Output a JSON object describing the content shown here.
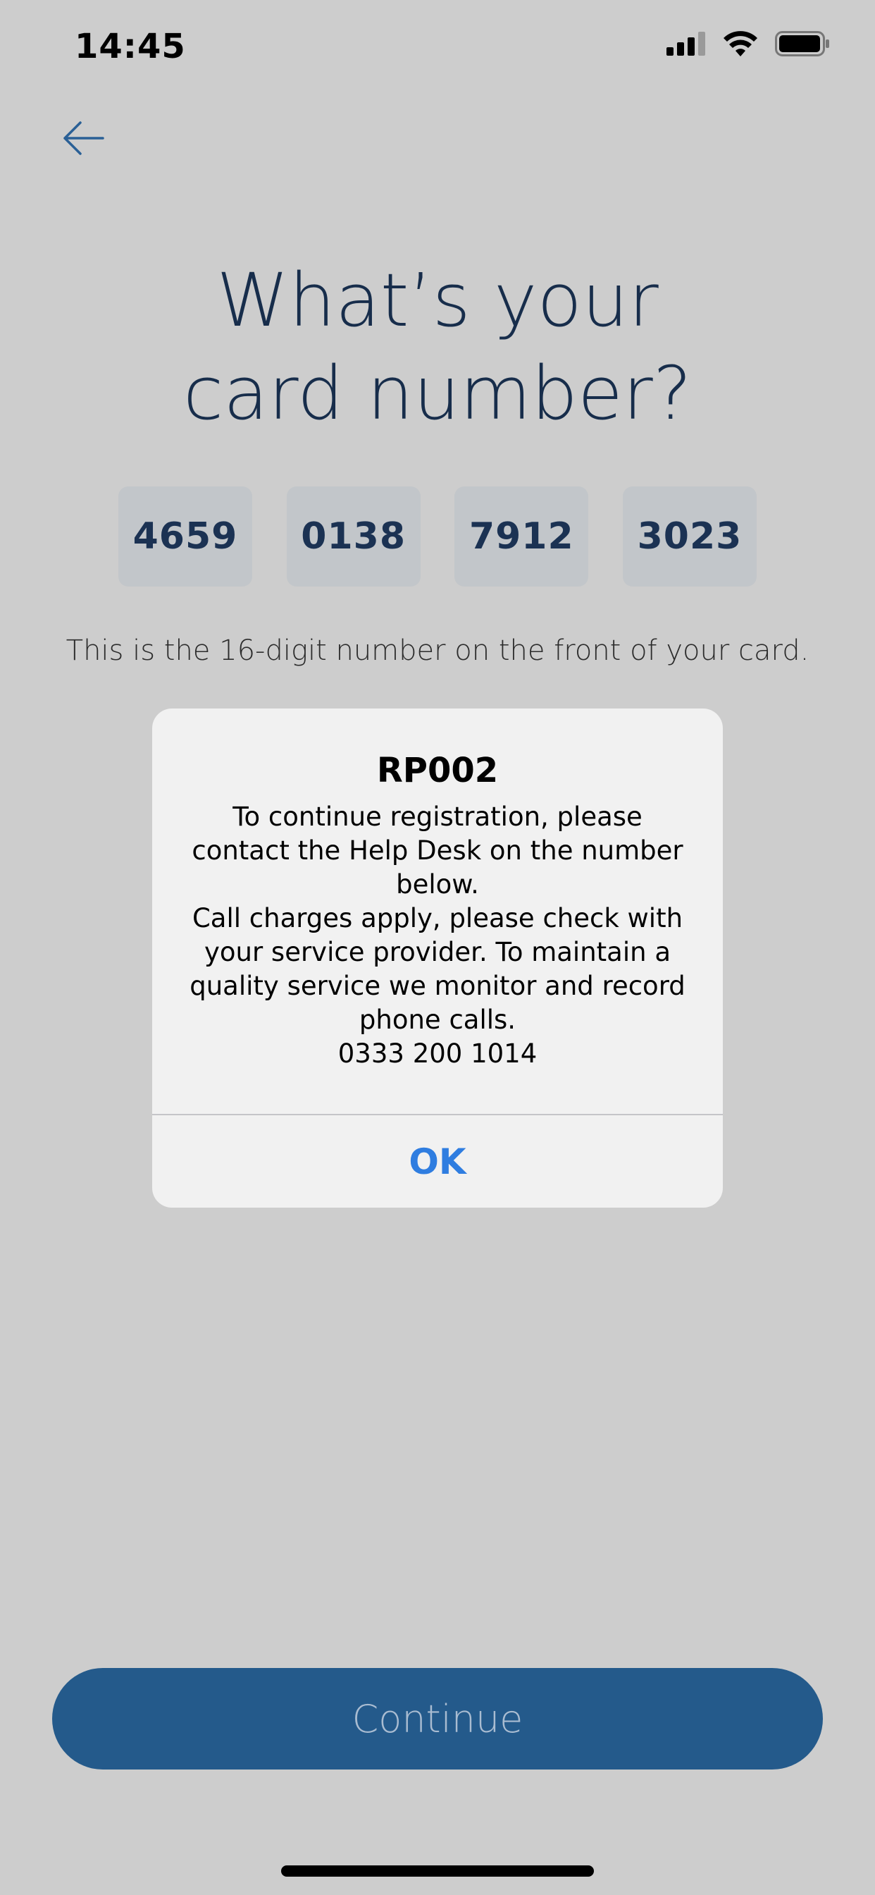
{
  "status_bar": {
    "time": "14:45",
    "icons": [
      "cellular-signal-icon",
      "wifi-icon",
      "battery-icon"
    ]
  },
  "header": {
    "back_icon": "arrow-left-icon",
    "title_line1": "What’s your",
    "title_line2": "card number?"
  },
  "card_number": {
    "groups": [
      "4659",
      "0138",
      "7912",
      "3023"
    ],
    "hint": "This is the 16-digit number on the front of your card."
  },
  "alert": {
    "title": "RP002",
    "message_lines": [
      "To continue registration, please",
      "contact the Help Desk on the number",
      "below.",
      "Call charges apply, please check with",
      "your service provider. To maintain a",
      "quality service we monitor and record",
      "phone calls.",
      "0333 200 1014"
    ],
    "ok_label": "OK"
  },
  "footer": {
    "continue_label": "Continue"
  },
  "colors": {
    "overlay_background": "#cdcdcd",
    "title": "#172d4b",
    "accent_blue": "#245a8b",
    "alert_button": "#2f7de0"
  }
}
